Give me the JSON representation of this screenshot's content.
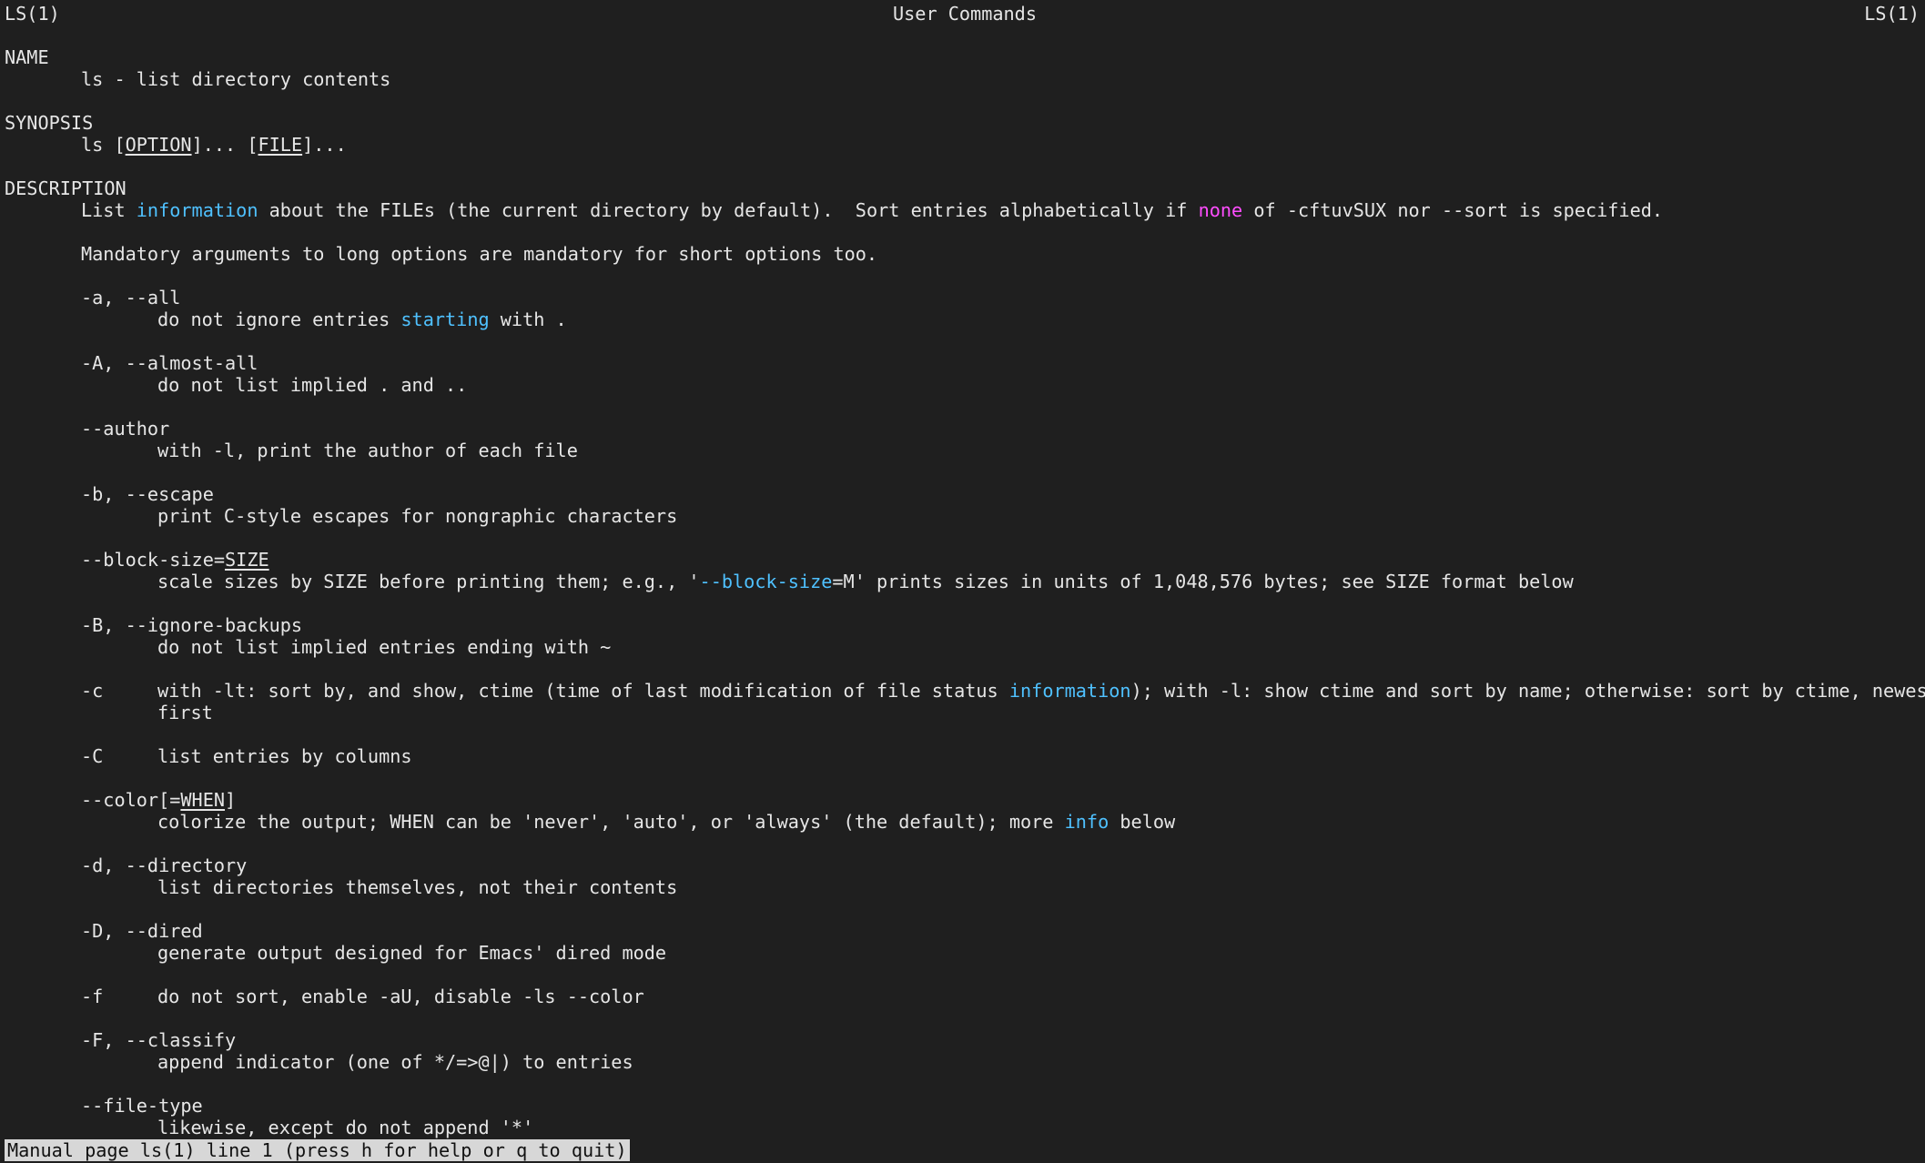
{
  "header": {
    "left": "LS(1)",
    "center": "User Commands",
    "right": "LS(1)"
  },
  "name_section": {
    "heading": "NAME",
    "text": "ls - list directory contents"
  },
  "synopsis": {
    "heading": "SYNOPSIS",
    "cmd": "ls",
    "b1": "[",
    "option": "OPTION",
    "b2": "]... [",
    "file": "FILE",
    "b3": "]..."
  },
  "description": {
    "heading": "DESCRIPTION",
    "p1": {
      "a": "List ",
      "hl1": "information",
      "b": " about the FILEs (the current directory by default).  Sort entries alphabetically if ",
      "hl2": "none",
      "c": " of -cftuvSUX nor --sort is specified."
    },
    "p2": "Mandatory arguments to long options are mandatory for short options too."
  },
  "options": {
    "a": {
      "flag": "-a, --all",
      "d1": "do not ignore entries ",
      "hl": "starting",
      "d2": " with ."
    },
    "A": {
      "flag": "-A, --almost-all",
      "desc": "do not list implied . and .."
    },
    "author": {
      "flag": "--author",
      "desc": "with -l, print the author of each file"
    },
    "b": {
      "flag": "-b, --escape",
      "desc": "print C-style escapes for nongraphic characters"
    },
    "block": {
      "flag1": "--block-size=",
      "flag2": "SIZE",
      "d1": "scale sizes by SIZE before printing them; e.g., '",
      "hl": "--block-size",
      "d2": "=M' prints sizes in units of 1,048,576 bytes; see SIZE format below"
    },
    "B": {
      "flag": "-B, --ignore-backups",
      "desc": "do not list implied entries ending with ~"
    },
    "c": {
      "flag": "-c",
      "d1": "with -lt: sort by, and show, ctime (time of last modification of file status ",
      "hl": "information",
      "d2": "); with -l: show ctime and sort by name; otherwise: sort by ctime, newest",
      "d3": "first"
    },
    "C": {
      "flag": "-C",
      "desc": "list entries by columns"
    },
    "color": {
      "flag1": "--color[=",
      "flag2": "WHEN",
      "flag3": "]",
      "d1": "colorize the output; WHEN can be 'never', 'auto', or 'always' (the default); more ",
      "hl": "info",
      "d2": " below"
    },
    "d": {
      "flag": "-d, --directory",
      "desc": "list directories themselves, not their contents"
    },
    "D": {
      "flag": "-D, --dired",
      "desc": "generate output designed for Emacs' dired mode"
    },
    "f": {
      "flag": "-f",
      "desc": "do not sort, enable -aU, disable -ls --color"
    },
    "F": {
      "flag": "-F, --classify",
      "desc": "append indicator (one of */=>@|) to entries"
    },
    "filetype": {
      "flag": "--file-type",
      "desc": "likewise, except do not append '*'"
    }
  },
  "colors": {
    "background": "#1f1f1f",
    "text": "#e6e6e6",
    "cyan": "#4fc1ff",
    "magenta": "#ff4dff",
    "status_bg": "#d7d7d7"
  },
  "status": "Manual page ls(1) line 1 (press h for help or q to quit)"
}
